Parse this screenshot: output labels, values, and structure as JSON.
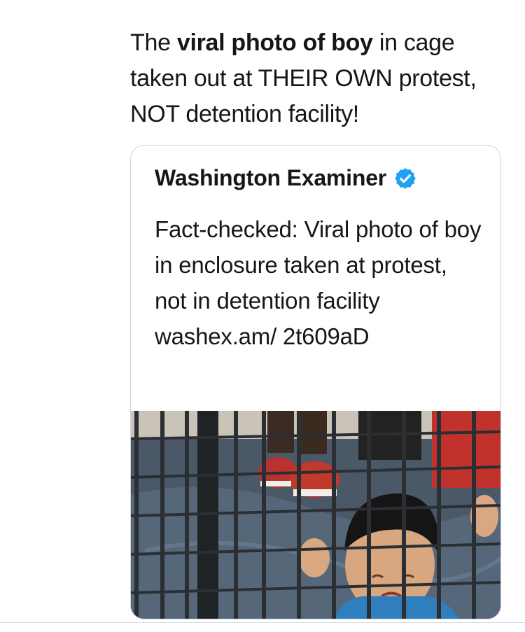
{
  "tweet": {
    "text_part1": "The ",
    "text_bold": "viral photo of boy",
    "text_part2": " in cage taken out at THEIR OWN protest, NOT detention facility!"
  },
  "quote": {
    "author_name": "Washington Examiner",
    "verified_icon": "verified-badge-icon",
    "body": "Fact-checked: Viral photo of boy in enclosure taken at protest, not in detention facility washex.am/ 2t609aD",
    "image_description_icon": "photo-thumbnail"
  },
  "colors": {
    "text": "#14171a",
    "verified": "#1da1f2",
    "card_border": "#ccd6dd"
  }
}
